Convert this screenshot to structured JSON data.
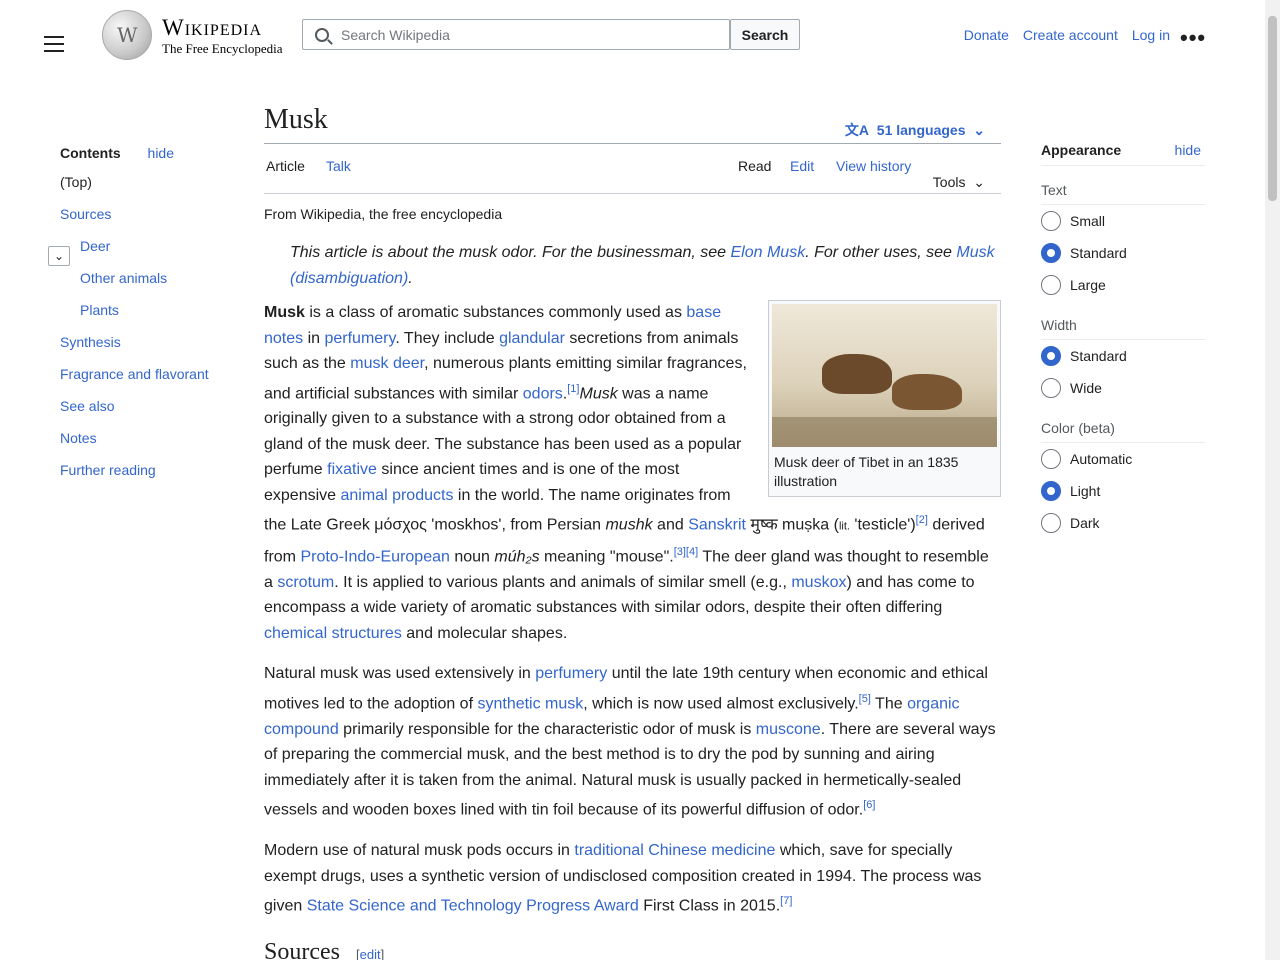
{
  "header": {
    "logo_title": "Wikipedia",
    "logo_tagline": "The Free Encyclopedia",
    "search_placeholder": "Search Wikipedia",
    "search_button": "Search",
    "donate": "Donate",
    "create_account": "Create account",
    "log_in": "Log in",
    "more": "•••"
  },
  "toc": {
    "title": "Contents",
    "hide": "hide",
    "items": [
      {
        "label": "(Top)",
        "level": 1
      },
      {
        "label": "Sources",
        "level": 1
      },
      {
        "label": "Deer",
        "level": 2
      },
      {
        "label": "Other animals",
        "level": 2
      },
      {
        "label": "Plants",
        "level": 2
      },
      {
        "label": "Synthesis",
        "level": 1
      },
      {
        "label": "Fragrance and flavorant",
        "level": 1
      },
      {
        "label": "See also",
        "level": 1
      },
      {
        "label": "Notes",
        "level": 1
      },
      {
        "label": "Further reading",
        "level": 1
      }
    ]
  },
  "article": {
    "title": "Musk",
    "languages": "51 languages",
    "tabs": {
      "article": "Article",
      "talk": "Talk",
      "read": "Read",
      "edit": "Edit",
      "history": "View history",
      "tools": "Tools"
    },
    "tagline": "From Wikipedia, the free encyclopedia",
    "hatnote": {
      "pre": "This article is about the musk odor. For the businessman, see ",
      "link1": "Elon Musk",
      "mid": ". For other uses, see ",
      "link2": "Musk (disambiguation)",
      "post": "."
    },
    "infobox_caption": "Musk deer of Tibet in an 1835 illustration",
    "p1": [
      {
        "b": "Musk"
      },
      {
        "t": " is a class of aromatic substances commonly used as "
      },
      {
        "a": "base notes"
      },
      {
        "t": " in "
      },
      {
        "a": "perfumery"
      },
      {
        "t": ". They include "
      },
      {
        "a": "glandular"
      },
      {
        "t": " secretions from animals such as the "
      },
      {
        "a": "musk deer"
      },
      {
        "t": ", numerous plants emitting similar fragrances, and artificial substances with similar "
      },
      {
        "a": "odors"
      },
      {
        "t": "."
      },
      {
        "a": "[1]"
      },
      {
        "i": "Musk"
      },
      {
        "t": " was a name originally given to a substance with a strong odor obtained from a gland of the musk deer. The substance has been used as a popular perfume "
      },
      {
        "a": "fixative"
      },
      {
        "t": " since ancient times and is one of the most expensive "
      },
      {
        "a": "animal products"
      },
      {
        "t": " in the world. The name originates from the Late Greek μόσχος 'moskhos', from Persian "
      },
      {
        "i": "mushk"
      },
      {
        "t": " and "
      },
      {
        "a": "Sanskrit"
      },
      {
        "t": " मुष्क muṣka ("
      },
      {
        "s": "lit."
      },
      {
        "t": " 'testicle')"
      },
      {
        "a": "[2]"
      },
      {
        "t": " derived from "
      },
      {
        "a": "Proto-Indo-European"
      },
      {
        "t": " noun "
      },
      {
        "i": "múh₂s"
      },
      {
        "t": " meaning \"mouse\"."
      },
      {
        "a": "[3][4]"
      },
      {
        "t": " The deer gland was thought to resemble a "
      },
      {
        "a": "scrotum"
      },
      {
        "t": ". It is applied to various plants and animals of similar smell (e.g., "
      },
      {
        "a": "muskox"
      },
      {
        "t": ") and has come to encompass a wide variety of aromatic substances with similar odors, despite their often differing "
      },
      {
        "a": "chemical structures"
      },
      {
        "t": " and molecular shapes."
      }
    ],
    "p2": [
      {
        "t": "Natural musk was used extensively in "
      },
      {
        "a": "perfumery"
      },
      {
        "t": " until the late 19th century when economic and ethical motives led to the adoption of "
      },
      {
        "a": "synthetic musk"
      },
      {
        "t": ", which is now used almost exclusively."
      },
      {
        "a": "[5]"
      },
      {
        "t": " The "
      },
      {
        "a": "organic compound"
      },
      {
        "t": " primarily responsible for the characteristic odor of musk is "
      },
      {
        "a": "muscone"
      },
      {
        "t": ". There are several ways of preparing the commercial musk, and the best method is to dry the pod by sunning and airing immediately after it is taken from the animal. Natural musk is usually packed in hermetically-sealed vessels and wooden boxes lined with tin foil because of its powerful diffusion of odor."
      },
      {
        "a": "[6]"
      }
    ],
    "p3": [
      {
        "t": "Modern use of natural musk pods occurs in "
      },
      {
        "a": "traditional Chinese medicine"
      },
      {
        "t": " which, save for specially exempt drugs, uses a synthetic version of undisclosed composition created in 1994. The process was given "
      },
      {
        "a": "State Science and Technology Progress Award"
      },
      {
        "t": " First Class in 2015."
      },
      {
        "a": "[7]"
      }
    ],
    "sources_heading": "Sources",
    "sources_edit": "edit"
  },
  "appearance": {
    "title": "Appearance",
    "hide": "hide",
    "text_label": "Text",
    "text_options": [
      "Small",
      "Standard",
      "Large"
    ],
    "text_selected": "Standard",
    "width_label": "Width",
    "width_options": [
      "Standard",
      "Wide"
    ],
    "width_selected": "Standard",
    "color_label": "Color (beta)",
    "color_options": [
      "Automatic",
      "Light",
      "Dark"
    ],
    "color_selected": "Light"
  },
  "colors": {
    "link": "#3366cc",
    "text": "#202122",
    "accent": "#3366cc"
  }
}
